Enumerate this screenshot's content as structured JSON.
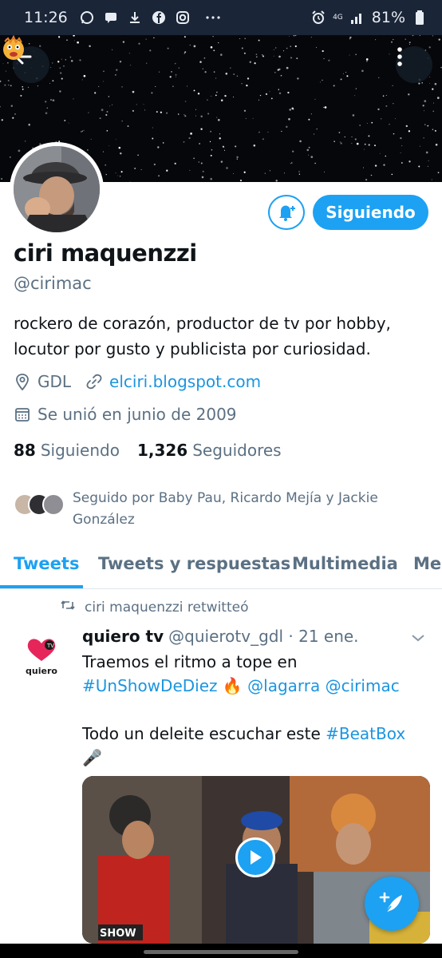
{
  "status_bar": {
    "time": "11:26",
    "left_icons": [
      "whatsapp-icon",
      "chat-icon",
      "download-icon",
      "facebook-icon",
      "instagram-icon",
      "more-dots-icon"
    ],
    "network": "4G",
    "battery": "81%"
  },
  "header": {
    "back_icon": "arrow-left-icon",
    "more_icon": "vertical-dots-icon"
  },
  "profile": {
    "follow_button": "Siguiendo",
    "notify_icon": "bell-plus-icon",
    "name": "ciri maquenzzi",
    "handle": "@cirimac",
    "bio_line1": "rockero de corazón, productor de tv por hobby,",
    "bio_line2": "locutor por gusto y publicista por curiosidad.",
    "location": "GDL",
    "website": "elciri.blogspot.com",
    "joined": "Se unió en junio de 2009",
    "following_count": "88",
    "following_label": "Siguiendo",
    "followers_count": "1,326",
    "followers_label": "Seguidores",
    "followed_by": "Seguido por Baby Pau, Ricardo Mejía y Jackie González"
  },
  "tabs": [
    {
      "label": "Tweets",
      "active": true
    },
    {
      "label": "Tweets y respuestas",
      "active": false
    },
    {
      "label": "Multimedia",
      "active": false
    },
    {
      "label": "Me",
      "active": false
    }
  ],
  "tweet": {
    "retweet_label": "ciri maquenzzi retwitteó",
    "author_name": "quiero tv",
    "author_meta": "@quierotv_gdl · 21 ene.",
    "avatar_label": "quiero",
    "body_p1": "Traemos el ritmo a tope en",
    "hashtag1": "#UnShowDeDiez",
    "emoji_fire": "🔥",
    "mention1": "@lagarra",
    "mention2": "@cirimac",
    "body_p2": "Todo un deleite escuchar este",
    "hashtag2": "#BeatBox",
    "emoji_mic": "🎤",
    "video_caption": "SHOW"
  },
  "colors": {
    "accent": "#1da1f2",
    "link": "#1b95e0",
    "muted": "#5b7083",
    "statusbar": "#1a2537"
  }
}
